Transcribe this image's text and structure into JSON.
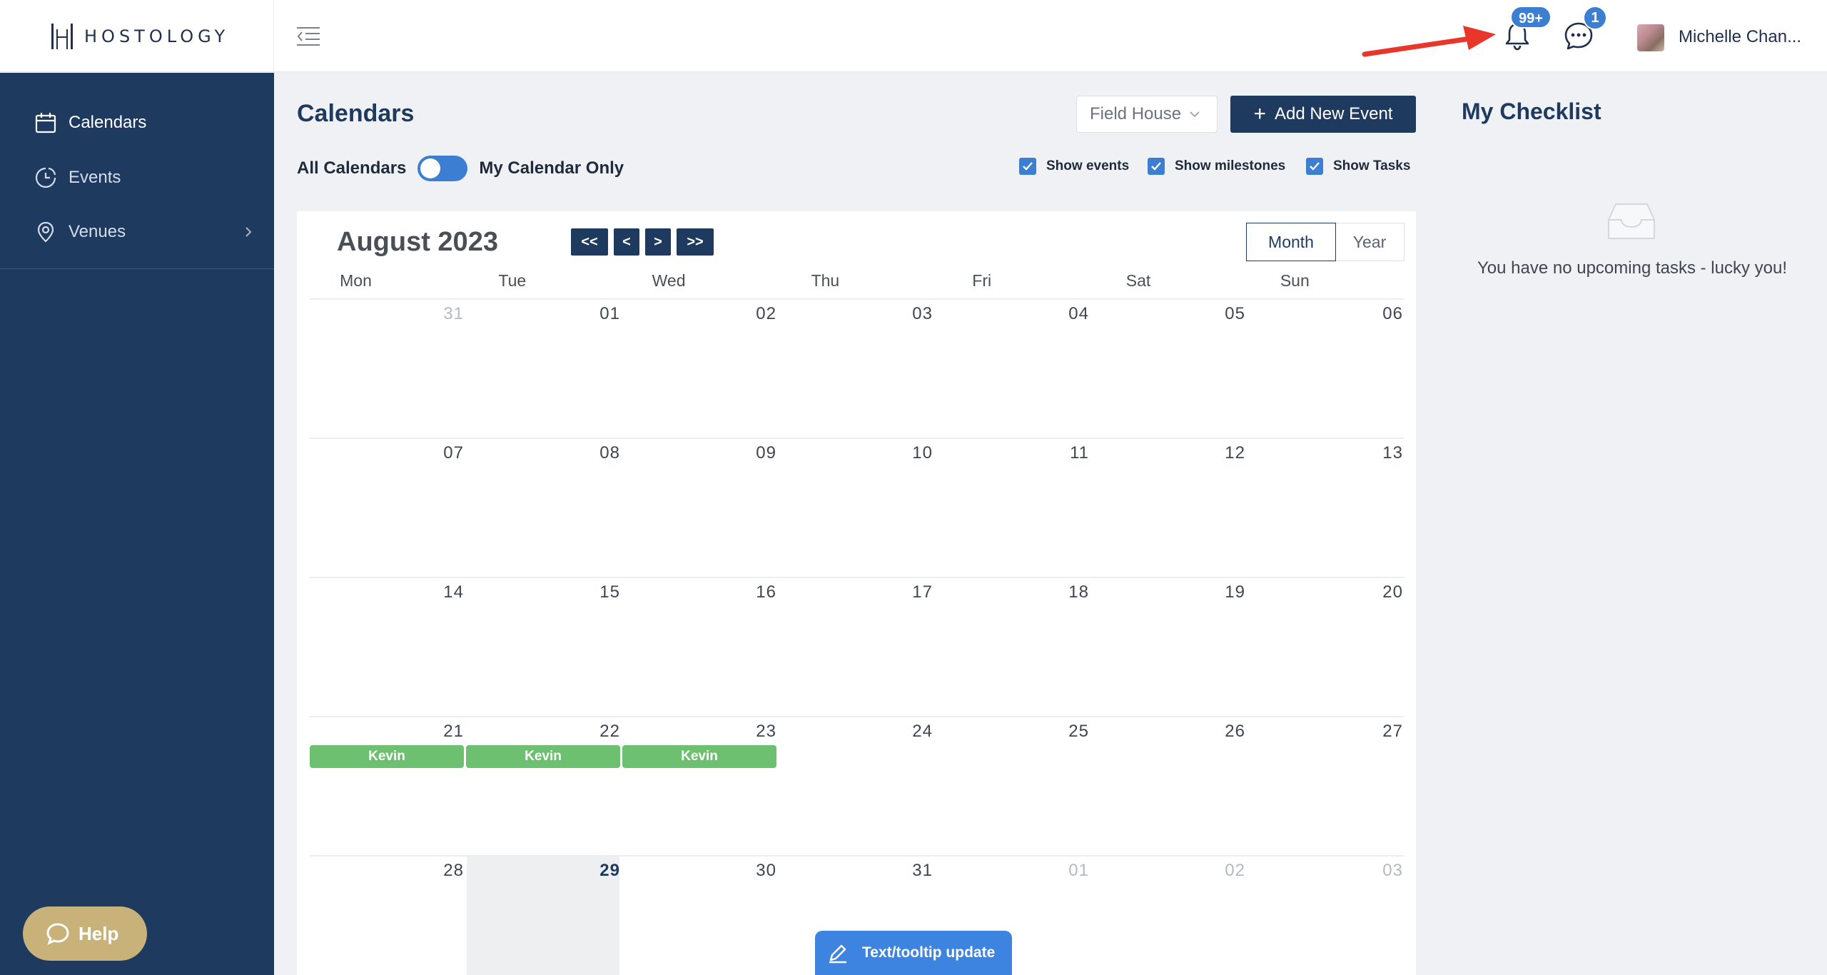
{
  "brand": {
    "name": "HOSTOLOGY"
  },
  "header": {
    "notifications_badge": "99+",
    "messages_badge": "1",
    "user_name": "Michelle Chan..."
  },
  "sidebar": {
    "items": [
      {
        "label": "Calendars",
        "icon": "calendar-icon"
      },
      {
        "label": "Events",
        "icon": "clock-pie-icon"
      },
      {
        "label": "Venues",
        "icon": "map-pin-icon"
      }
    ],
    "help_label": "Help"
  },
  "main": {
    "title": "Calendars",
    "venue_select": "Field House",
    "add_button": "Add New Event",
    "toggle_left": "All Calendars",
    "toggle_right": "My Calendar Only",
    "checkboxes": [
      {
        "label": "Show events",
        "checked": true
      },
      {
        "label": "Show milestones",
        "checked": true
      },
      {
        "label": "Show Tasks",
        "checked": true
      }
    ]
  },
  "calendar": {
    "month_label": "August 2023",
    "nav": [
      "<<",
      "<",
      ">",
      ">>"
    ],
    "view_tabs": [
      "Month",
      "Year"
    ],
    "active_view": "Month",
    "weekdays": [
      "Mon",
      "Tue",
      "Wed",
      "Thu",
      "Fri",
      "Sat",
      "Sun"
    ],
    "weeks": [
      [
        "31",
        "01",
        "02",
        "03",
        "04",
        "05",
        "06"
      ],
      [
        "07",
        "08",
        "09",
        "10",
        "11",
        "12",
        "13"
      ],
      [
        "14",
        "15",
        "16",
        "17",
        "18",
        "19",
        "20"
      ],
      [
        "21",
        "22",
        "23",
        "24",
        "25",
        "26",
        "27"
      ],
      [
        "28",
        "29",
        "30",
        "31",
        "01",
        "02",
        "03"
      ]
    ],
    "today": "29",
    "events": [
      {
        "label": "Kevin",
        "day": "21"
      },
      {
        "label": "Kevin",
        "day": "22"
      },
      {
        "label": "Kevin",
        "day": "23"
      }
    ]
  },
  "checklist": {
    "title": "My Checklist",
    "empty_text": "You have no upcoming tasks - lucky you!"
  },
  "update_pill": {
    "label": "Text/tooltip update"
  },
  "colors": {
    "sidebar": "#1e3a5f",
    "accent": "#3b7ed2",
    "event": "#6cc070",
    "help": "#c8b27a",
    "annotation_arrow": "#e8362b"
  }
}
